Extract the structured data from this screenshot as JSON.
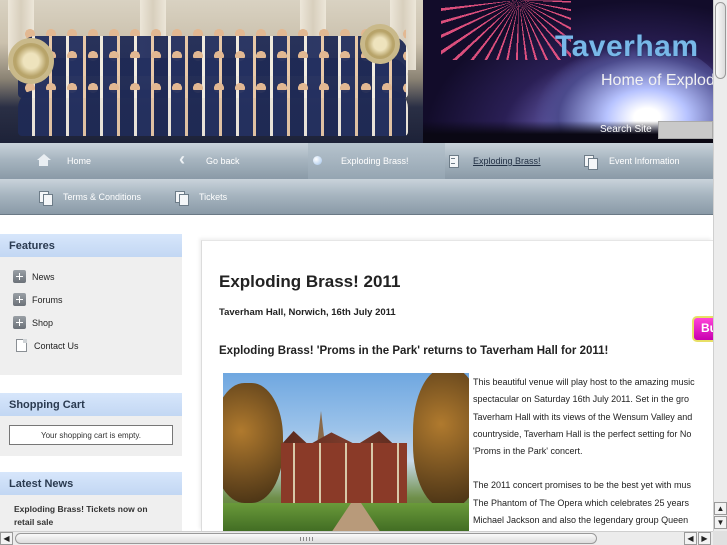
{
  "header": {
    "site_title": "Taverham",
    "site_subtitle": "Home of Explod",
    "search_label": "Search Site",
    "search_value": ""
  },
  "nav": {
    "row1": [
      {
        "label": "Home",
        "icon": "home-icon"
      },
      {
        "label": "Go back",
        "icon": "back-arrow-icon"
      },
      {
        "label": "Exploding Brass!",
        "icon": "bullet-icon",
        "state": "active"
      },
      {
        "label": "Exploding Brass!",
        "icon": "document-icon",
        "state": "current"
      },
      {
        "label": "Event Information",
        "icon": "documents-icon"
      }
    ],
    "row2": [
      {
        "label": "Terms & Conditions",
        "icon": "documents-icon"
      },
      {
        "label": "Tickets",
        "icon": "documents-icon"
      }
    ]
  },
  "sidebar": {
    "features": {
      "title": "Features",
      "items": [
        {
          "label": "News",
          "icon": "expand-plus-icon"
        },
        {
          "label": "Forums",
          "icon": "expand-plus-icon"
        },
        {
          "label": "Shop",
          "icon": "expand-plus-icon"
        },
        {
          "label": "Contact Us",
          "icon": "page-icon"
        }
      ]
    },
    "cart": {
      "title": "Shopping Cart",
      "message": "Your shopping cart is empty."
    },
    "news": {
      "title": "Latest News",
      "items": [
        "Exploding Brass! Tickets now on retail sale"
      ]
    }
  },
  "main": {
    "title": "Exploding Brass! 2011",
    "subtitle": "Taverham Hall, Norwich, 16th July 2011",
    "buy_label": "Bu",
    "heading": "Exploding Brass! 'Proms in the Park' returns to Taverham Hall for 2011!",
    "paragraphs": [
      [
        "This beautiful venue will play host to the amazing music",
        "spectacular on Saturday 16th July 2011.  Set in the gro",
        "Taverham Hall with its views of the Wensum Valley and",
        "countryside, Taverham Hall is the perfect setting for No",
        "'Proms in the Park' concert."
      ],
      [
        "The 2011 concert promises to be the best yet with mus",
        "The Phantom of The Opera which celebrates 25 years",
        "Michael Jackson and also the legendary group Queen"
      ]
    ]
  },
  "colors": {
    "nav_gradient_top": "#c9d3db",
    "nav_gradient_bottom": "#8a9aa7",
    "box_header": "#c2d7f3",
    "title_blue": "#78b8e8",
    "buy_button": "#e020c8"
  }
}
